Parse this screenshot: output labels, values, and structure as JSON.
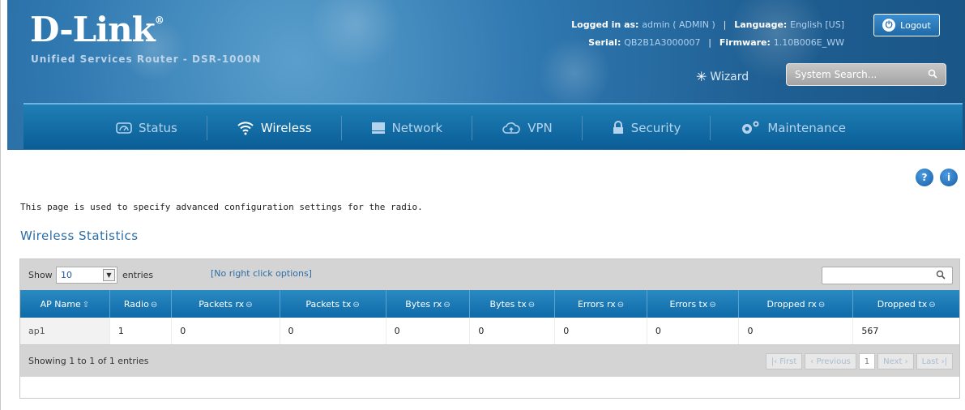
{
  "header": {
    "logo": "D-Link",
    "logo_reg": "®",
    "subtitle": "Unified Services Router - DSR-1000N",
    "logged_in_label": "Logged in as:",
    "logged_in_value": "admin ( ADMIN )",
    "language_label": "Language:",
    "language_value": "English [US]",
    "serial_label": "Serial:",
    "serial_value": "QB2B1A3000007",
    "firmware_label": "Firmware:",
    "firmware_value": "1.10B006E_WW",
    "logout_label": "Logout",
    "wizard_label": "Wizard",
    "search_placeholder": "System Search..."
  },
  "nav": {
    "items": [
      {
        "label": "Status",
        "icon": "dashboard-icon"
      },
      {
        "label": "Wireless",
        "icon": "wifi-icon"
      },
      {
        "label": "Network",
        "icon": "network-icon"
      },
      {
        "label": "VPN",
        "icon": "cloud-icon"
      },
      {
        "label": "Security",
        "icon": "lock-icon"
      },
      {
        "label": "Maintenance",
        "icon": "gears-icon"
      }
    ],
    "active": "Wireless"
  },
  "page": {
    "help_icon": "?",
    "info_icon": "i",
    "description": "This page is used to specify advanced configuration settings for the radio.",
    "section_title": "Wireless Statistics"
  },
  "table": {
    "show_label": "Show",
    "entries_value": "10",
    "entries_label": "entries",
    "context_note": "[No right click options]",
    "columns": [
      "AP Name",
      "Radio",
      "Packets rx",
      "Packets tx",
      "Bytes rx",
      "Bytes tx",
      "Errors rx",
      "Errors tx",
      "Dropped rx",
      "Dropped tx"
    ],
    "rows": [
      [
        "ap1",
        "1",
        "0",
        "0",
        "0",
        "0",
        "0",
        "0",
        "0",
        "567"
      ]
    ],
    "showing_text": "Showing 1 to 1 of 1 entries",
    "pager": {
      "first": "First",
      "previous": "Previous",
      "current": "1",
      "next": "Next",
      "last": "Last"
    }
  }
}
